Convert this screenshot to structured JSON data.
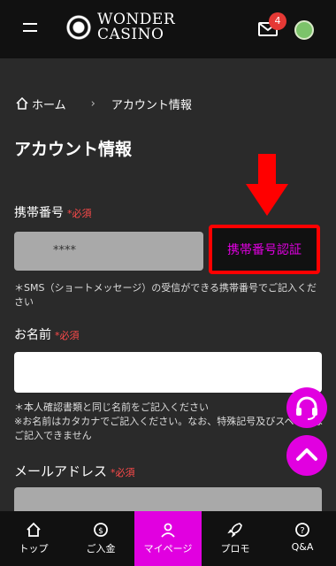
{
  "header": {
    "logo_line1": "WONDER",
    "logo_line2": "CASINO",
    "mail_badge": "4"
  },
  "breadcrumb": {
    "home": "ホーム",
    "current": "アカウント情報"
  },
  "page_title": "アカウント情報",
  "form": {
    "required": "必須",
    "phone": {
      "label": "携帯番号",
      "value": "****",
      "verify_button": "携帯番号認証",
      "note": "＊SMS（ショートメッセージ）の受信ができる携帯番号でご記入ください"
    },
    "name": {
      "label": "お名前",
      "value": "",
      "note_line1": "＊本人確認書類と同じ名前をご記入ください",
      "note_line2": "※お名前はカタカナでご記入ください。なお、特殊記号及びスペースはご記入できません"
    },
    "email": {
      "label": "メールアドレス"
    }
  },
  "bottom_nav": [
    {
      "label": "トップ",
      "icon": "home-icon"
    },
    {
      "label": "ご入金",
      "icon": "deposit-icon"
    },
    {
      "label": "マイページ",
      "icon": "user-icon"
    },
    {
      "label": "プロモ",
      "icon": "rocket-icon"
    },
    {
      "label": "Q&A",
      "icon": "question-icon"
    }
  ],
  "colors": {
    "accent": "#e100e0",
    "required": "#ff4a4a",
    "highlight_box": "#ff0000",
    "background": "#2a2a2a"
  }
}
